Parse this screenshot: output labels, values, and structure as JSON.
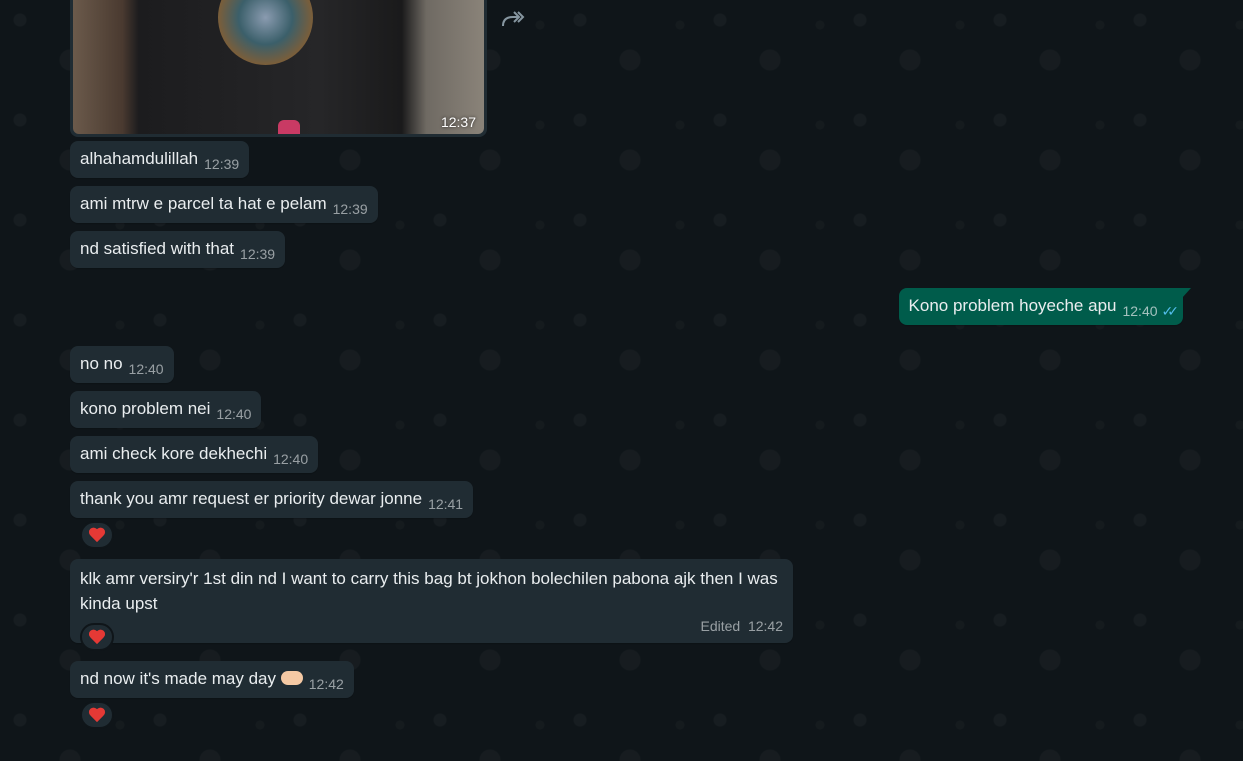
{
  "chat": {
    "image_message": {
      "time": "12:37"
    },
    "messages": [
      {
        "text": "alhahamdulillah",
        "time": "12:39"
      },
      {
        "text": "ami mtrw e parcel ta hat e pelam",
        "time": "12:39"
      },
      {
        "text": "nd satisfied with that",
        "time": "12:39"
      },
      {
        "text": "Kono problem hoyeche apu",
        "time": "12:40",
        "direction": "out",
        "status": "read"
      },
      {
        "text": "no no",
        "time": "12:40"
      },
      {
        "text": "kono problem nei",
        "time": "12:40"
      },
      {
        "text": "ami check kore dekhechi",
        "time": "12:40"
      },
      {
        "text": "thank you amr request er priority dewar jonne",
        "time": "12:41",
        "reaction": "red-heart"
      },
      {
        "text": "klk amr versiry'r 1st din nd I want to carry this bag bt jokhon bolechilen pabona ajk then I was kinda upst",
        "time": "12:42",
        "edited_label": "Edited",
        "reaction": "red-heart"
      },
      {
        "text": "nd now it's made may day",
        "emoji": "heart-hands",
        "time": "12:42",
        "reaction": "red-heart"
      }
    ]
  },
  "colors": {
    "background": "#0f1519",
    "incoming_bubble": "#202c33",
    "outgoing_bubble": "#005c4b",
    "read_ticks": "#53bdeb",
    "reaction_heart": "#e53935"
  }
}
